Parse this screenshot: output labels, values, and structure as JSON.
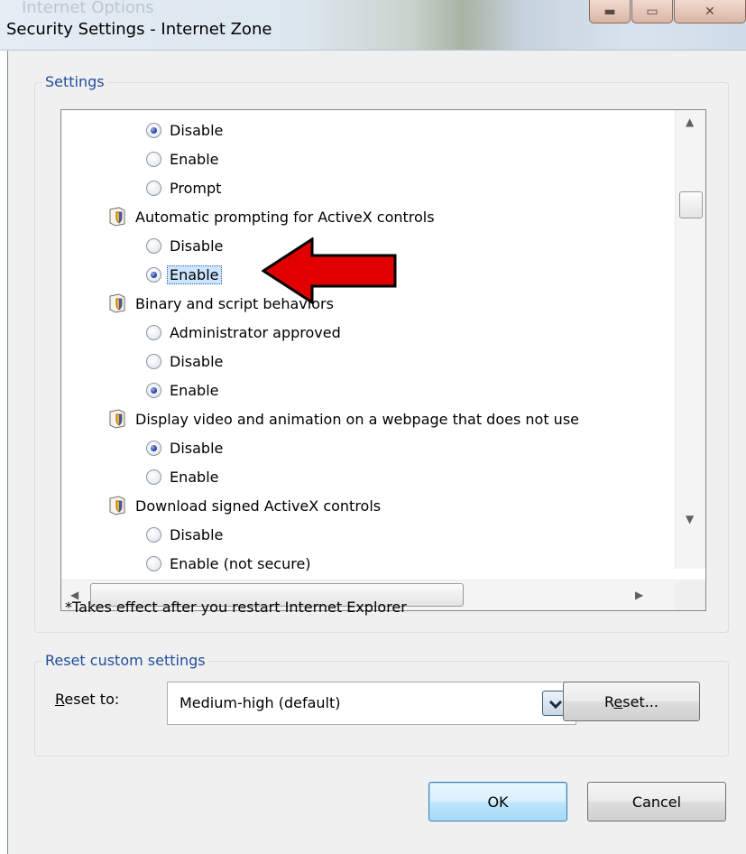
{
  "window": {
    "ghost_title": "Internet Options",
    "title": "Security Settings - Internet Zone"
  },
  "settings_group": {
    "label": "Settings",
    "list": [
      {
        "kind": "radio",
        "label": "Disable",
        "checked": true
      },
      {
        "kind": "radio",
        "label": "Enable",
        "checked": false
      },
      {
        "kind": "radio",
        "label": "Prompt",
        "checked": false
      },
      {
        "kind": "heading",
        "label": "Automatic prompting for ActiveX controls"
      },
      {
        "kind": "radio",
        "label": "Disable",
        "checked": false
      },
      {
        "kind": "radio",
        "label": "Enable",
        "checked": true,
        "selected": true
      },
      {
        "kind": "heading",
        "label": "Binary and script behaviors"
      },
      {
        "kind": "radio",
        "label": "Administrator approved",
        "checked": false
      },
      {
        "kind": "radio",
        "label": "Disable",
        "checked": false
      },
      {
        "kind": "radio",
        "label": "Enable",
        "checked": true
      },
      {
        "kind": "heading",
        "label": "Display video and animation on a webpage that does not use"
      },
      {
        "kind": "radio",
        "label": "Disable",
        "checked": true
      },
      {
        "kind": "radio",
        "label": "Enable",
        "checked": false
      },
      {
        "kind": "heading",
        "label": "Download signed ActiveX controls"
      },
      {
        "kind": "radio",
        "label": "Disable",
        "checked": false
      },
      {
        "kind": "radio",
        "label": "Enable (not secure)",
        "checked": false
      }
    ],
    "note": "*Takes effect after you restart Internet Explorer"
  },
  "reset_group": {
    "label": "Reset custom settings",
    "reset_to_label": "Reset to:",
    "selected_value": "Medium-high (default)",
    "reset_button": "Reset..."
  },
  "buttons": {
    "ok": "OK",
    "cancel": "Cancel"
  },
  "colors": {
    "group_label": "#1e4e9b",
    "selection": "#cce6ff",
    "callout_arrow": "#e00000"
  }
}
